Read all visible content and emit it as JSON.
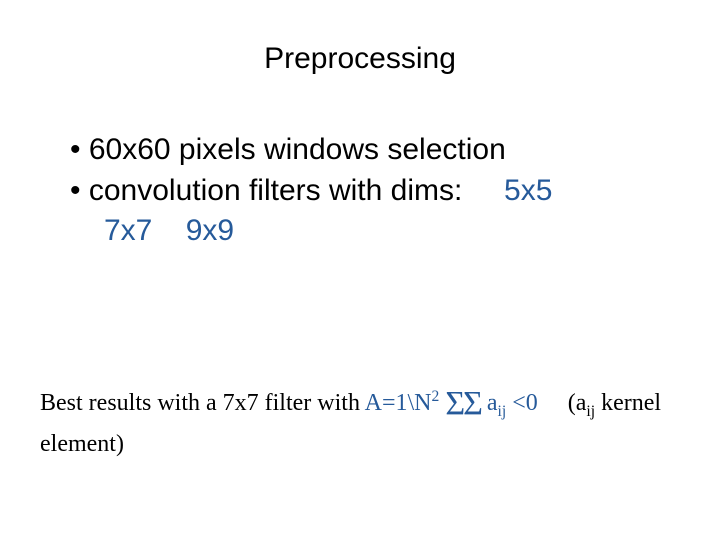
{
  "title": "Preprocessing",
  "bullets": {
    "b1": {
      "dot": "•",
      "text": "60x60 pixels windows selection"
    },
    "b2": {
      "dot": "•",
      "text": "convolution filters with dims:",
      "d1": "5x5",
      "d2": "7x7",
      "d3": "9x9"
    }
  },
  "footnote": {
    "pre": "Best results with a 7x7 filter with ",
    "formula": {
      "a": "A=1\\N",
      "sup2": "2",
      "sigma": "ΣΣ",
      "aij_a": "a",
      "aij_ij": "ij",
      "lt0": "<0"
    },
    "post_open": "(a",
    "post_ij": "ij",
    "post_rest": " kernel element)"
  }
}
